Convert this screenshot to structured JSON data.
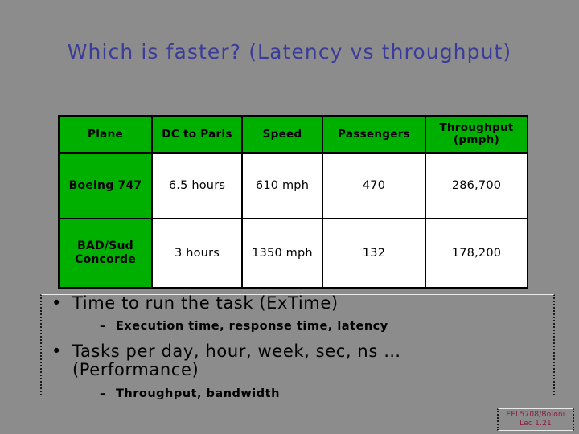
{
  "slide": {
    "title": "Which is faster? (Latency vs throughput)",
    "background_color": "#8c8c8c",
    "title_color": "#3b3b99"
  },
  "table": {
    "header_fill": "#00b000",
    "cell_fill": "#ffffff",
    "border_color": "#000000",
    "columns": [
      "Plane",
      "DC to Paris",
      "Speed",
      "Passengers",
      "Throughput (pmph)"
    ],
    "column_labels": {
      "throughput_line1": "Throughput",
      "throughput_line2": "(pmph)"
    },
    "rows": [
      {
        "plane_line1": "Boeing 747",
        "plane_line2": "",
        "dc_to_paris": "6.5 hours",
        "speed": "610 mph",
        "passengers": "470",
        "throughput": "286,700"
      },
      {
        "plane_line1": "BAD/Sud",
        "plane_line2": "Concorde",
        "dc_to_paris": "3 hours",
        "speed": "1350 mph",
        "passengers": "132",
        "throughput": "178,200"
      }
    ]
  },
  "body": {
    "bullets": [
      {
        "marker": "•",
        "text": "Time to run the task  (ExTime)"
      },
      {
        "marker": "–",
        "text": "Execution time, response time, latency"
      },
      {
        "marker": "•",
        "text_line1": "Tasks per day, hour, week, sec, ns …",
        "text_line2": "(Performance)"
      },
      {
        "marker": "–",
        "text": "Throughput, bandwidth"
      }
    ]
  },
  "footer": {
    "line1": "EEL5708/Bölöni",
    "line2": "Lec  1.21",
    "color": "#8b1a3d"
  }
}
